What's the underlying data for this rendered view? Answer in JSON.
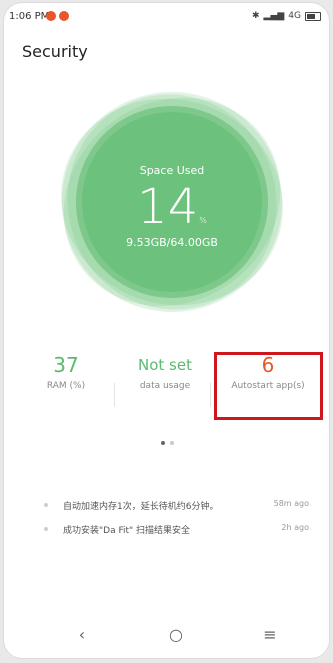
{
  "status_bar": {
    "time": "1:06 PM",
    "signal_text": "4G",
    "icons": [
      "notification-icon",
      "notification-icon",
      "bluetooth-icon",
      "signal-icon",
      "battery-icon"
    ]
  },
  "header": {
    "title": "Security"
  },
  "storage": {
    "label": "Space Used",
    "percent": "14",
    "unit": "%",
    "detail": "9.53GB/64.00GB",
    "color": "#5cba70"
  },
  "stats": [
    {
      "value": "37",
      "label": "RAM (%)"
    },
    {
      "value": "Not set",
      "label": "data usage"
    },
    {
      "value": "6",
      "label": "Autostart app(s)"
    }
  ],
  "pager": {
    "pages": 2,
    "active": 1
  },
  "feed": [
    {
      "text": "自动加速内存1次，延长待机约6分钟。",
      "time": "58m ago"
    },
    {
      "text": "成功安装\"Da Fit\" 扫描结果安全",
      "time": "2h ago"
    }
  ],
  "nav": {
    "back": "‹",
    "home": "○",
    "menu": "≡"
  },
  "colors": {
    "accent_green": "#5cba70",
    "accent_orange": "#e8562a",
    "highlight_red": "#d0161d"
  }
}
